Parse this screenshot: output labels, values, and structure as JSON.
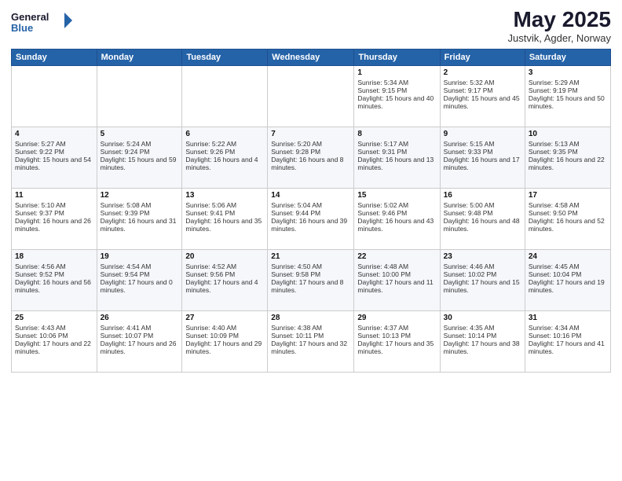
{
  "logo": {
    "line1": "General",
    "line2": "Blue"
  },
  "title": "May 2025",
  "location": "Justvik, Agder, Norway",
  "days_header": [
    "Sunday",
    "Monday",
    "Tuesday",
    "Wednesday",
    "Thursday",
    "Friday",
    "Saturday"
  ],
  "weeks": [
    [
      {
        "day": "",
        "sunrise": "",
        "sunset": "",
        "daylight": ""
      },
      {
        "day": "",
        "sunrise": "",
        "sunset": "",
        "daylight": ""
      },
      {
        "day": "",
        "sunrise": "",
        "sunset": "",
        "daylight": ""
      },
      {
        "day": "",
        "sunrise": "",
        "sunset": "",
        "daylight": ""
      },
      {
        "day": "1",
        "sunrise": "Sunrise: 5:34 AM",
        "sunset": "Sunset: 9:15 PM",
        "daylight": "Daylight: 15 hours and 40 minutes."
      },
      {
        "day": "2",
        "sunrise": "Sunrise: 5:32 AM",
        "sunset": "Sunset: 9:17 PM",
        "daylight": "Daylight: 15 hours and 45 minutes."
      },
      {
        "day": "3",
        "sunrise": "Sunrise: 5:29 AM",
        "sunset": "Sunset: 9:19 PM",
        "daylight": "Daylight: 15 hours and 50 minutes."
      }
    ],
    [
      {
        "day": "4",
        "sunrise": "Sunrise: 5:27 AM",
        "sunset": "Sunset: 9:22 PM",
        "daylight": "Daylight: 15 hours and 54 minutes."
      },
      {
        "day": "5",
        "sunrise": "Sunrise: 5:24 AM",
        "sunset": "Sunset: 9:24 PM",
        "daylight": "Daylight: 15 hours and 59 minutes."
      },
      {
        "day": "6",
        "sunrise": "Sunrise: 5:22 AM",
        "sunset": "Sunset: 9:26 PM",
        "daylight": "Daylight: 16 hours and 4 minutes."
      },
      {
        "day": "7",
        "sunrise": "Sunrise: 5:20 AM",
        "sunset": "Sunset: 9:28 PM",
        "daylight": "Daylight: 16 hours and 8 minutes."
      },
      {
        "day": "8",
        "sunrise": "Sunrise: 5:17 AM",
        "sunset": "Sunset: 9:31 PM",
        "daylight": "Daylight: 16 hours and 13 minutes."
      },
      {
        "day": "9",
        "sunrise": "Sunrise: 5:15 AM",
        "sunset": "Sunset: 9:33 PM",
        "daylight": "Daylight: 16 hours and 17 minutes."
      },
      {
        "day": "10",
        "sunrise": "Sunrise: 5:13 AM",
        "sunset": "Sunset: 9:35 PM",
        "daylight": "Daylight: 16 hours and 22 minutes."
      }
    ],
    [
      {
        "day": "11",
        "sunrise": "Sunrise: 5:10 AM",
        "sunset": "Sunset: 9:37 PM",
        "daylight": "Daylight: 16 hours and 26 minutes."
      },
      {
        "day": "12",
        "sunrise": "Sunrise: 5:08 AM",
        "sunset": "Sunset: 9:39 PM",
        "daylight": "Daylight: 16 hours and 31 minutes."
      },
      {
        "day": "13",
        "sunrise": "Sunrise: 5:06 AM",
        "sunset": "Sunset: 9:41 PM",
        "daylight": "Daylight: 16 hours and 35 minutes."
      },
      {
        "day": "14",
        "sunrise": "Sunrise: 5:04 AM",
        "sunset": "Sunset: 9:44 PM",
        "daylight": "Daylight: 16 hours and 39 minutes."
      },
      {
        "day": "15",
        "sunrise": "Sunrise: 5:02 AM",
        "sunset": "Sunset: 9:46 PM",
        "daylight": "Daylight: 16 hours and 43 minutes."
      },
      {
        "day": "16",
        "sunrise": "Sunrise: 5:00 AM",
        "sunset": "Sunset: 9:48 PM",
        "daylight": "Daylight: 16 hours and 48 minutes."
      },
      {
        "day": "17",
        "sunrise": "Sunrise: 4:58 AM",
        "sunset": "Sunset: 9:50 PM",
        "daylight": "Daylight: 16 hours and 52 minutes."
      }
    ],
    [
      {
        "day": "18",
        "sunrise": "Sunrise: 4:56 AM",
        "sunset": "Sunset: 9:52 PM",
        "daylight": "Daylight: 16 hours and 56 minutes."
      },
      {
        "day": "19",
        "sunrise": "Sunrise: 4:54 AM",
        "sunset": "Sunset: 9:54 PM",
        "daylight": "Daylight: 17 hours and 0 minutes."
      },
      {
        "day": "20",
        "sunrise": "Sunrise: 4:52 AM",
        "sunset": "Sunset: 9:56 PM",
        "daylight": "Daylight: 17 hours and 4 minutes."
      },
      {
        "day": "21",
        "sunrise": "Sunrise: 4:50 AM",
        "sunset": "Sunset: 9:58 PM",
        "daylight": "Daylight: 17 hours and 8 minutes."
      },
      {
        "day": "22",
        "sunrise": "Sunrise: 4:48 AM",
        "sunset": "Sunset: 10:00 PM",
        "daylight": "Daylight: 17 hours and 11 minutes."
      },
      {
        "day": "23",
        "sunrise": "Sunrise: 4:46 AM",
        "sunset": "Sunset: 10:02 PM",
        "daylight": "Daylight: 17 hours and 15 minutes."
      },
      {
        "day": "24",
        "sunrise": "Sunrise: 4:45 AM",
        "sunset": "Sunset: 10:04 PM",
        "daylight": "Daylight: 17 hours and 19 minutes."
      }
    ],
    [
      {
        "day": "25",
        "sunrise": "Sunrise: 4:43 AM",
        "sunset": "Sunset: 10:06 PM",
        "daylight": "Daylight: 17 hours and 22 minutes."
      },
      {
        "day": "26",
        "sunrise": "Sunrise: 4:41 AM",
        "sunset": "Sunset: 10:07 PM",
        "daylight": "Daylight: 17 hours and 26 minutes."
      },
      {
        "day": "27",
        "sunrise": "Sunrise: 4:40 AM",
        "sunset": "Sunset: 10:09 PM",
        "daylight": "Daylight: 17 hours and 29 minutes."
      },
      {
        "day": "28",
        "sunrise": "Sunrise: 4:38 AM",
        "sunset": "Sunset: 10:11 PM",
        "daylight": "Daylight: 17 hours and 32 minutes."
      },
      {
        "day": "29",
        "sunrise": "Sunrise: 4:37 AM",
        "sunset": "Sunset: 10:13 PM",
        "daylight": "Daylight: 17 hours and 35 minutes."
      },
      {
        "day": "30",
        "sunrise": "Sunrise: 4:35 AM",
        "sunset": "Sunset: 10:14 PM",
        "daylight": "Daylight: 17 hours and 38 minutes."
      },
      {
        "day": "31",
        "sunrise": "Sunrise: 4:34 AM",
        "sunset": "Sunset: 10:16 PM",
        "daylight": "Daylight: 17 hours and 41 minutes."
      }
    ]
  ]
}
